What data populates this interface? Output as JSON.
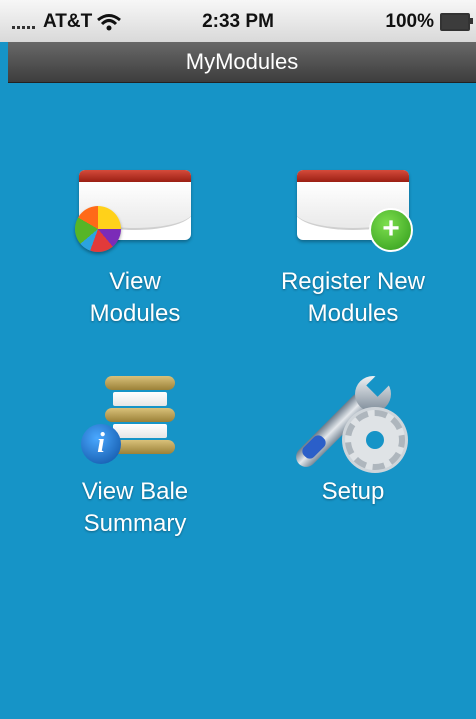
{
  "status_bar": {
    "carrier": "AT&T",
    "time": "2:33 PM",
    "battery": "100%"
  },
  "nav": {
    "title": "MyModules"
  },
  "menu": [
    {
      "line1": "View",
      "line2": "Modules",
      "icon": "folder-piechart-icon"
    },
    {
      "line1": "Register New",
      "line2": "Modules",
      "icon": "folder-add-icon"
    },
    {
      "line1": "View Bale",
      "line2": "Summary",
      "icon": "bale-stack-info-icon"
    },
    {
      "line1": "Setup",
      "line2": "",
      "icon": "wrench-gear-icon"
    }
  ]
}
